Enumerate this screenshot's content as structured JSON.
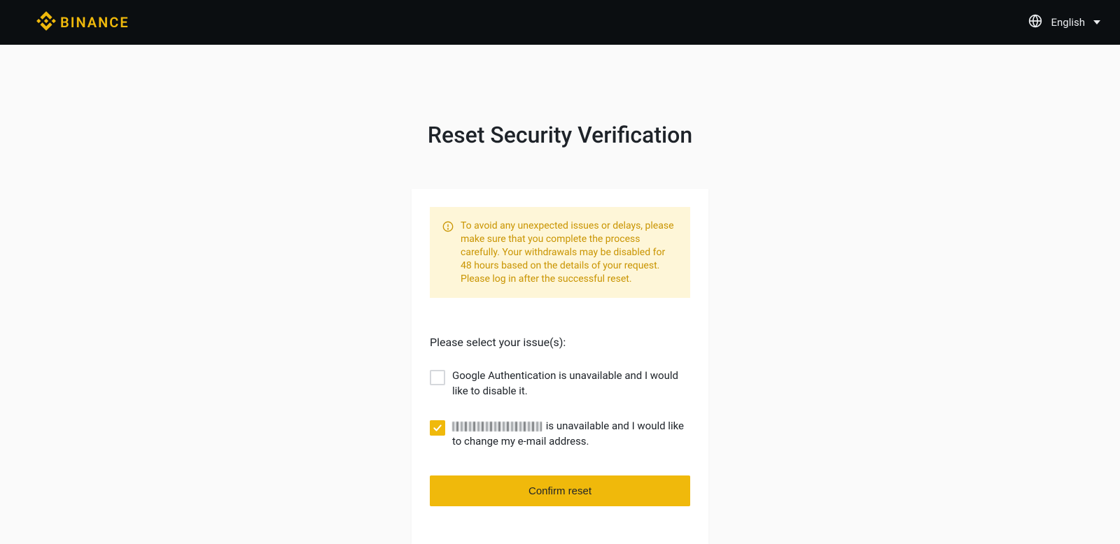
{
  "header": {
    "brand": "BINANCE",
    "language": "English"
  },
  "main": {
    "title": "Reset Security Verification",
    "notice": "To avoid any unexpected issues or delays, please make sure that you complete the process carefully. Your withdrawals may be disabled for 48 hours based on the details of your request.\nPlease log in after the successful reset.",
    "prompt": "Please select your issue(s):",
    "options": [
      {
        "label": "Google Authentication is unavailable and I would like to disable it.",
        "checked": false
      },
      {
        "label_suffix": " is unavailable and I would like to change my e-mail address.",
        "redacted_prefix": true,
        "checked": true
      }
    ],
    "confirm_label": "Confirm reset"
  }
}
